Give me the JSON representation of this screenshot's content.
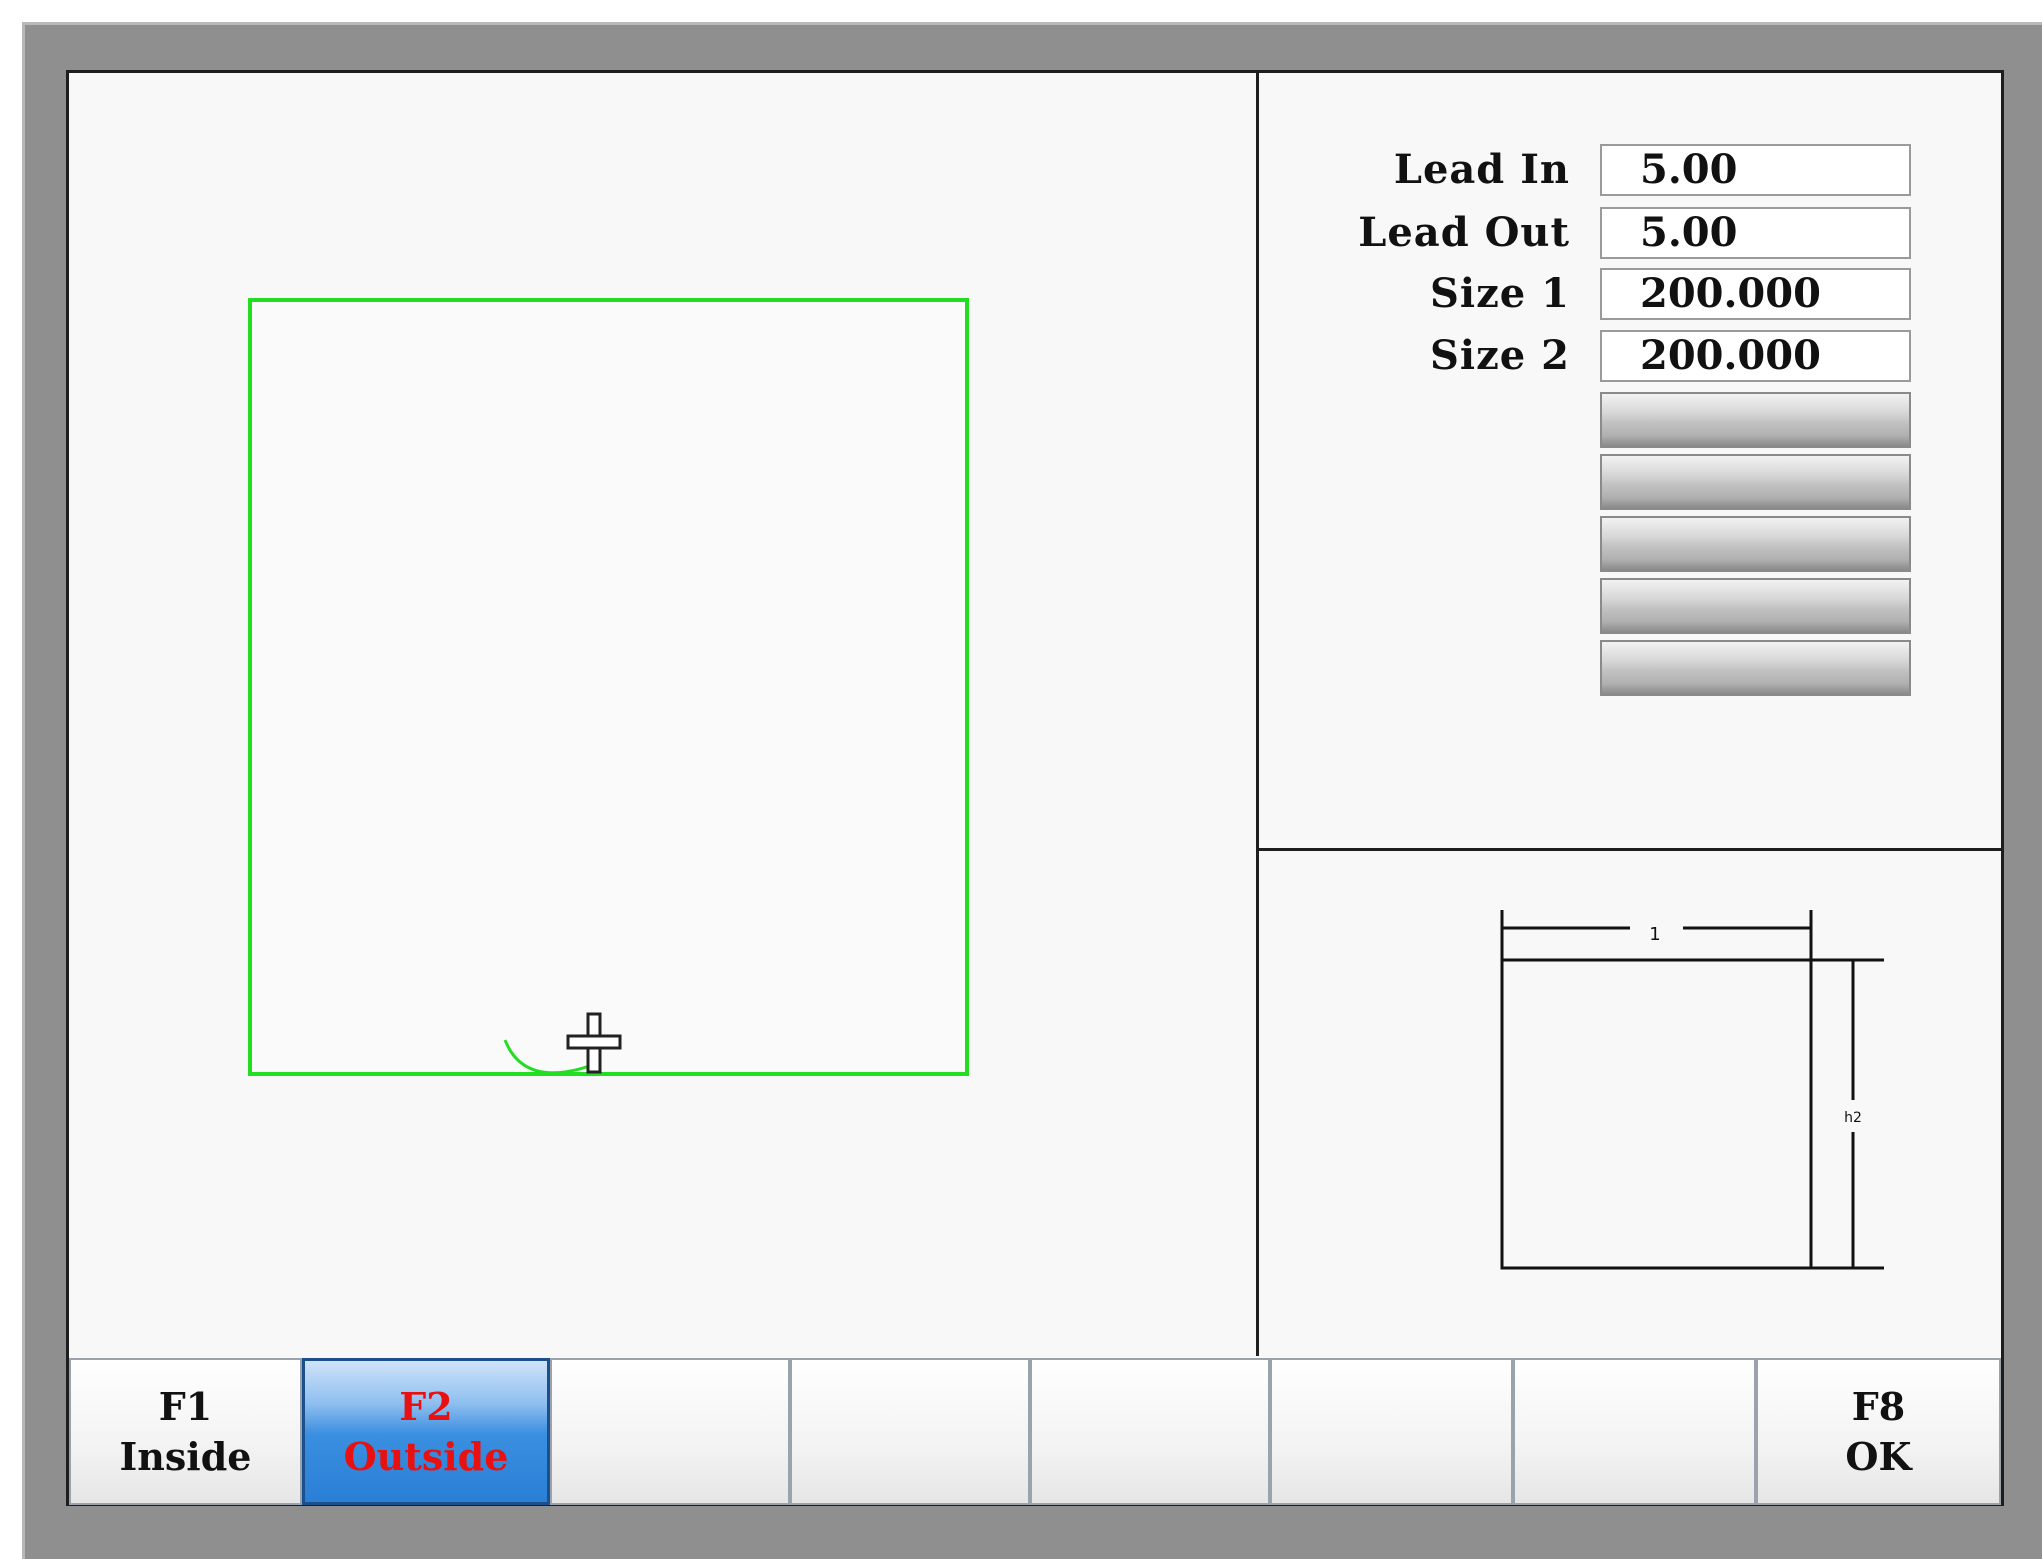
{
  "params": [
    {
      "label": "Lead In",
      "value": "5.00"
    },
    {
      "label": "Lead Out",
      "value": "5.00"
    },
    {
      "label": "Size 1",
      "value": "200.000"
    },
    {
      "label": "Size 2",
      "value": "200.000"
    }
  ],
  "empty_param_count": 5,
  "diagram": {
    "dim_top": "1",
    "dim_side": "h2"
  },
  "function_keys": [
    {
      "key": "F1",
      "label": "Inside",
      "active": false
    },
    {
      "key": "F2",
      "label": "Outside",
      "active": true
    },
    {
      "key": "",
      "label": "",
      "active": false
    },
    {
      "key": "",
      "label": "",
      "active": false
    },
    {
      "key": "",
      "label": "",
      "active": false
    },
    {
      "key": "",
      "label": "",
      "active": false
    },
    {
      "key": "",
      "label": "",
      "active": false
    },
    {
      "key": "F8",
      "label": "OK",
      "active": false
    }
  ],
  "colors": {
    "shape_outline": "#22dd22",
    "active_key_text": "#e81010"
  }
}
